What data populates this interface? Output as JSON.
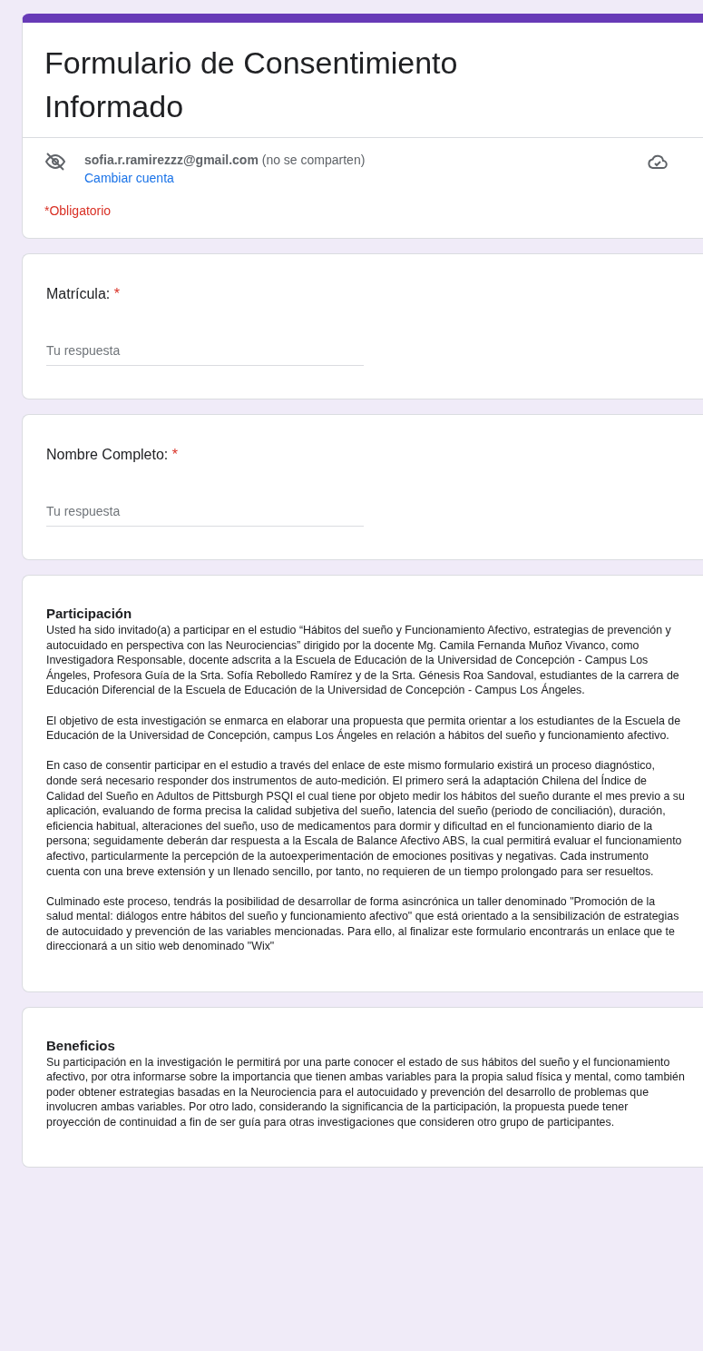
{
  "header": {
    "title": "Formulario de Consentimiento Informado",
    "email": "sofia.r.ramirezzz@gmail.com",
    "email_note": "(no se comparten)",
    "switch_account": "Cambiar cuenta",
    "required_note": "*Obligatorio"
  },
  "questions": [
    {
      "label": "Matrícula:",
      "required_mark": "*",
      "placeholder": "Tu respuesta"
    },
    {
      "label": "Nombre Completo:",
      "required_mark": "*",
      "placeholder": "Tu respuesta"
    }
  ],
  "sections": [
    {
      "title": "Participación",
      "paragraphs": [
        "Usted ha sido invitado(a) a participar en el estudio “Hábitos del sueño y Funcionamiento Afectivo, estrategias de prevención y autocuidado en perspectiva con las Neurociencias” dirigido por la docente Mg. Camila Fernanda Muñoz Vivanco, como Investigadora Responsable, docente adscrita a la Escuela de Educación de la Universidad de Concepción - Campus Los Ángeles, Profesora Guía de la Srta. Sofía Rebolledo Ramírez y de la Srta. Génesis Roa Sandoval, estudiantes de la carrera de Educación Diferencial de la Escuela de Educación de la Universidad de Concepción - Campus Los Ángeles.",
        "El objetivo de esta investigación se enmarca en elaborar una propuesta que permita orientar a los estudiantes de la Escuela de Educación de la Universidad de Concepción, campus Los Ángeles en relación a hábitos del sueño y funcionamiento afectivo.",
        "En caso de consentir participar en el estudio a través del enlace de este mismo formulario existirá un proceso diagnóstico, donde será necesario responder dos instrumentos de auto-medición. El primero será la adaptación Chilena del Índice de Calidad del Sueño en Adultos de Pittsburgh PSQI el cual tiene por objeto medir los hábitos del sueño durante el mes previo a su aplicación, evaluando de forma precisa la calidad subjetiva del sueño, latencia del sueño (periodo de conciliación), duración, eficiencia habitual, alteraciones del sueño, uso de medicamentos para dormir y dificultad en el funcionamiento diario de la persona; seguidamente deberán dar respuesta a la Escala de Balance Afectivo ABS, la cual permitirá evaluar el funcionamiento afectivo, particularmente la percepción de la autoexperimentación de emociones positivas y negativas. Cada instrumento cuenta con una breve extensión y un llenado sencillo, por tanto, no requieren de un tiempo prolongado para ser resueltos.",
        "Culminado este proceso, tendrás la posibilidad de desarrollar de forma asincrónica un taller denominado \"Promoción de la salud mental: diálogos entre hábitos del sueño y funcionamiento afectivo\" que está orientado a la sensibilización de estrategias de autocuidado y prevención de las variables mencionadas. Para ello, al finalizar este formulario encontrarás un enlace que te direccionará a un sitio web denominado \"Wix\""
      ]
    },
    {
      "title": "Beneficios",
      "paragraphs": [
        "Su participación en la investigación le permitirá por una parte conocer el estado de sus hábitos del sueño y el funcionamiento afectivo, por otra informarse sobre la importancia que tienen ambas variables para la propia salud física y mental, como también poder obtener estrategias basadas en la Neurociencia para el autocuidado y prevención del desarrollo de problemas que involucren ambas variables. Por otro lado, considerando la significancia de la participación, la propuesta puede tener proyección de continuidad a fin de ser guía para otras investigaciones que consideren otro grupo de participantes."
      ]
    }
  ]
}
